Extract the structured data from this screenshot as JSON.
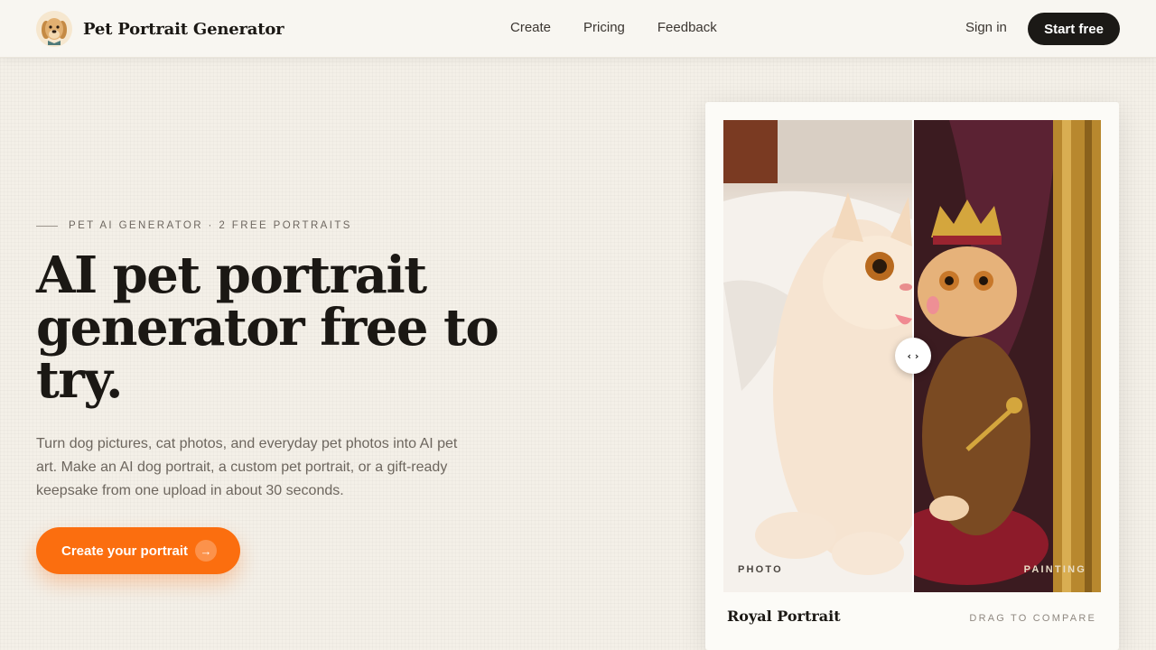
{
  "header": {
    "brand": "Pet Portrait Generator",
    "nav": [
      "Create",
      "Pricing",
      "Feedback"
    ],
    "sign_in": "Sign in",
    "start_free": "Start free"
  },
  "hero": {
    "eyebrow": "PET AI GENERATOR · 2 FREE PORTRAITS",
    "headline_lines": [
      "AI pet portrait",
      "generator free to",
      "try."
    ],
    "subtext": "Turn dog pictures, cat photos, and everyday pet photos into AI pet art. Make an AI dog portrait, a custom pet portrait, or a gift-ready keepsake from one upload in about 30 seconds.",
    "cta": "Create your portrait",
    "cta_icon": "arrow-right-icon"
  },
  "comparison": {
    "left_label": "PHOTO",
    "right_label": "PAINTING",
    "title": "Royal Portrait",
    "hint": "DRAG TO COMPARE",
    "handle_glyph": "‹ ›"
  },
  "colors": {
    "accent": "#fb6e0f",
    "dark": "#1b1916",
    "background": "#f4f0e8"
  }
}
